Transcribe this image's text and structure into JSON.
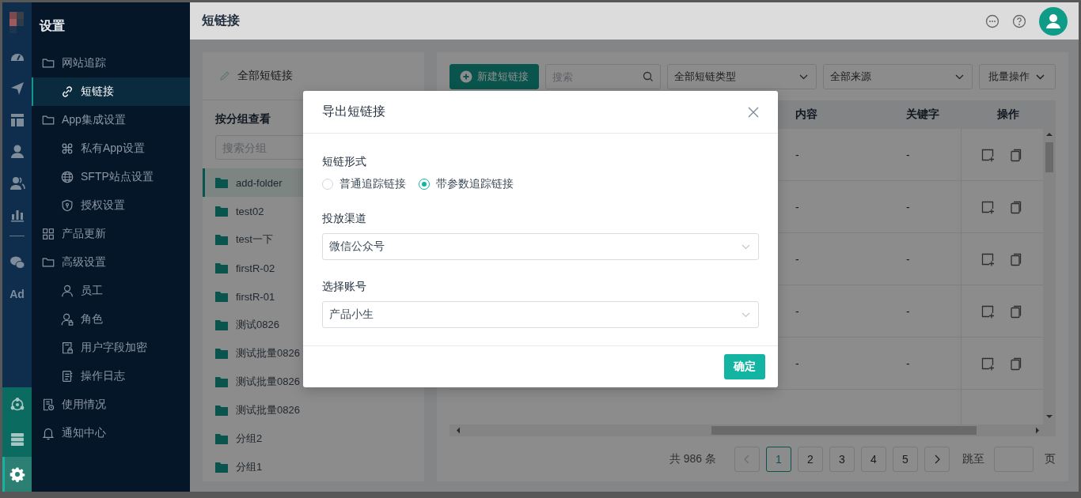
{
  "rail": {
    "items": [
      {
        "kind": "gauge",
        "selected": false
      },
      {
        "kind": "send",
        "selected": false
      },
      {
        "kind": "layout",
        "selected": false
      },
      {
        "kind": "user",
        "selected": false
      },
      {
        "kind": "users",
        "selected": false
      },
      {
        "kind": "chart",
        "selected": false
      },
      {
        "kind": "divider"
      },
      {
        "kind": "chat",
        "selected": false
      },
      {
        "kind": "text",
        "label": "Ad",
        "selected": false
      }
    ],
    "bottom": [
      {
        "kind": "hub",
        "selected": false
      },
      {
        "kind": "server",
        "selected": false
      },
      {
        "kind": "gear",
        "selected": true
      }
    ]
  },
  "sidebar": {
    "title": "设置",
    "items": [
      {
        "label": "网站追踪",
        "kind": "folder",
        "selected": false,
        "children": [
          {
            "label": "短链接",
            "kind": "link",
            "selected": true
          }
        ]
      },
      {
        "label": "App集成设置",
        "kind": "folder",
        "selected": false,
        "children": [
          {
            "label": "私有App设置",
            "kind": "command",
            "selected": false
          },
          {
            "label": "SFTP站点设置",
            "kind": "globe",
            "selected": false
          },
          {
            "label": "授权设置",
            "kind": "shield",
            "selected": false
          }
        ]
      },
      {
        "label": "产品更新",
        "kind": "grid",
        "selected": false
      },
      {
        "label": "高级设置",
        "kind": "folder",
        "selected": false,
        "children": [
          {
            "label": "员工",
            "kind": "user",
            "selected": false
          },
          {
            "label": "角色",
            "kind": "role",
            "selected": false
          },
          {
            "label": "用户字段加密",
            "kind": "lockfile",
            "selected": false
          },
          {
            "label": "操作日志",
            "kind": "log",
            "selected": false
          }
        ]
      },
      {
        "label": "使用情况",
        "kind": "report",
        "selected": false
      },
      {
        "label": "通知中心",
        "kind": "bell",
        "selected": false
      }
    ]
  },
  "header": {
    "title": "短链接"
  },
  "groups": {
    "all_label": "全部短链接",
    "heading": "按分组查看",
    "search": {
      "placeholder": "搜索分组"
    },
    "items": [
      {
        "label": "add-folder",
        "selected": true
      },
      {
        "label": "test02",
        "selected": false
      },
      {
        "label": "test一下",
        "selected": false
      },
      {
        "label": "firstR-02",
        "selected": false
      },
      {
        "label": "firstR-01",
        "selected": false
      },
      {
        "label": "测试0826",
        "selected": false
      },
      {
        "label": "测试批量0826",
        "selected": false
      },
      {
        "label": "测试批量0826",
        "selected": false
      },
      {
        "label": "测试批量0826",
        "selected": false
      },
      {
        "label": "分组2",
        "selected": false
      },
      {
        "label": "分组1",
        "selected": false
      }
    ]
  },
  "toolbar": {
    "new_button": "新建短链接",
    "search": {
      "placeholder": "搜索"
    },
    "type_filter": {
      "value": "全部短链类型"
    },
    "source_filter": {
      "value": "全部来源"
    },
    "bulk_button": "批量操作"
  },
  "table": {
    "columns": [
      "内容",
      "关键字",
      "操作"
    ],
    "rows": [
      {
        "content": "-",
        "keyword": "-"
      },
      {
        "content": "-",
        "keyword": "-"
      },
      {
        "content": "-",
        "keyword": "-"
      },
      {
        "content": "-",
        "keyword": "-"
      },
      {
        "content": "-",
        "keyword": "-"
      }
    ]
  },
  "pagination": {
    "total": "共 986 条",
    "prev_disabled": true,
    "next_disabled": false,
    "pages": [
      {
        "label": "1",
        "selected": true
      },
      {
        "label": "2",
        "selected": false
      },
      {
        "label": "3",
        "selected": false
      },
      {
        "label": "4",
        "selected": false
      },
      {
        "label": "5",
        "selected": false
      }
    ],
    "jump_label": "跳至",
    "page_suffix": "页"
  },
  "dialog": {
    "title": "导出短链接",
    "form_label": "短链形式",
    "options": [
      {
        "label": "普通追踪链接",
        "selected": false
      },
      {
        "label": "带参数追踪链接",
        "selected": true
      }
    ],
    "channel": {
      "label": "投放渠道",
      "value": "微信公众号"
    },
    "account": {
      "label": "选择账号",
      "value": "产品小生"
    },
    "confirm": "确定"
  }
}
